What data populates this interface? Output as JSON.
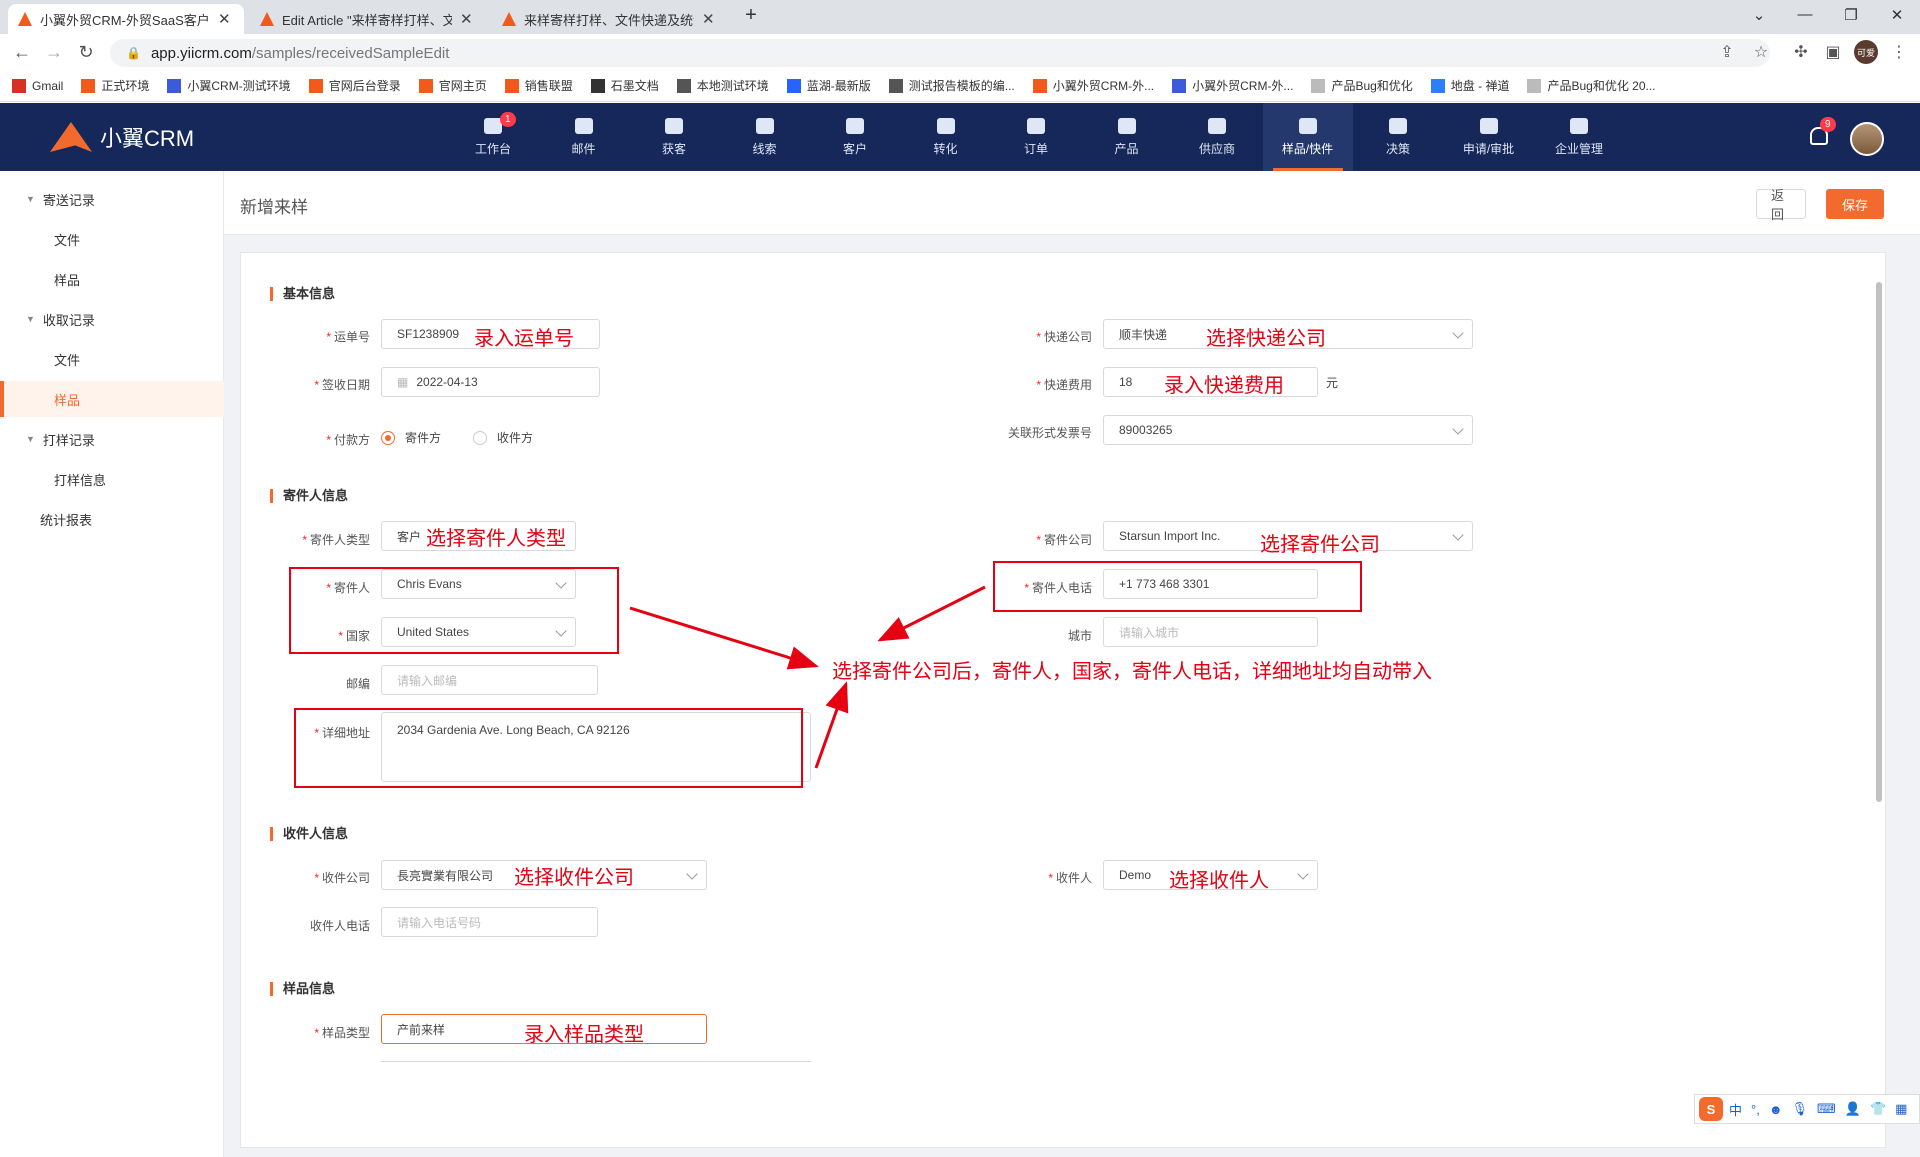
{
  "browser": {
    "tabs": [
      {
        "title": "小翼外贸CRM-外贸SaaS客户管理",
        "active": true
      },
      {
        "title": "Edit Article \"来样寄样打样、文件",
        "active": false
      },
      {
        "title": "来样寄样打样、文件快递及统计 -",
        "active": false
      }
    ],
    "new_tab": "+",
    "url_host": "app.yiicrm.com",
    "url_path": "/samples/receivedSampleEdit",
    "profile_label": "可爱",
    "bookmarks": [
      "Gmail",
      "正式环境",
      "小翼CRM-测试环境",
      "官网后台登录",
      "官网主页",
      "销售联盟",
      "石墨文档",
      "本地测试环境",
      "蓝湖-最新版",
      "测试报告模板的编...",
      "小翼外贸CRM-外...",
      "小翼外贸CRM-外...",
      "产品Bug和优化",
      "地盘 - 禅道",
      "产品Bug和优化 20..."
    ]
  },
  "app": {
    "logo_text": "小翼CRM",
    "nav": [
      {
        "label": "工作台",
        "badge": "1"
      },
      {
        "label": "邮件"
      },
      {
        "label": "获客"
      },
      {
        "label": "线索"
      },
      {
        "label": "客户"
      },
      {
        "label": "转化"
      },
      {
        "label": "订单"
      },
      {
        "label": "产品"
      },
      {
        "label": "供应商"
      },
      {
        "label": "样品/快件",
        "active": true
      },
      {
        "label": "决策"
      },
      {
        "label": "申请/审批"
      },
      {
        "label": "企业管理"
      }
    ],
    "notification_count": "9"
  },
  "sidebar": {
    "items": [
      {
        "label": "寄送记录",
        "type": "group"
      },
      {
        "label": "文件",
        "type": "child"
      },
      {
        "label": "样品",
        "type": "child"
      },
      {
        "label": "收取记录",
        "type": "group"
      },
      {
        "label": "文件",
        "type": "child"
      },
      {
        "label": "样品",
        "type": "child",
        "active": true
      },
      {
        "label": "打样记录",
        "type": "group"
      },
      {
        "label": "打样信息",
        "type": "child"
      },
      {
        "label": "统计报表",
        "type": "plain"
      }
    ]
  },
  "page": {
    "title": "新增来样",
    "back_label": "返回",
    "save_label": "保存"
  },
  "form": {
    "basic": {
      "section": "基本信息",
      "waybill_label": "运单号",
      "waybill_value": "SF1238909",
      "courier_label": "快递公司",
      "courier_value": "顺丰快递",
      "date_label": "签收日期",
      "date_value": "2022-04-13",
      "fee_label": "快递费用",
      "fee_value": "18",
      "fee_unit": "元",
      "payer_label": "付款方",
      "payer_options": [
        "寄件方",
        "收件方"
      ],
      "payer_selected": "寄件方",
      "invoice_label": "关联形式发票号",
      "invoice_value": "89003265"
    },
    "sender": {
      "section": "寄件人信息",
      "type_label": "寄件人类型",
      "type_value": "客户",
      "company_label": "寄件公司",
      "company_value": "Starsun Import Inc.",
      "name_label": "寄件人",
      "name_value": "Chris Evans",
      "phone_label": "寄件人电话",
      "phone_value": "+1 773 468 3301",
      "country_label": "国家",
      "country_value": "United States",
      "city_label": "城市",
      "city_placeholder": "请输入城市",
      "zip_label": "邮编",
      "zip_placeholder": "请输入邮编",
      "address_label": "详细地址",
      "address_value": "2034 Gardenia Ave. Long Beach, CA 92126"
    },
    "receiver": {
      "section": "收件人信息",
      "company_label": "收件公司",
      "company_value": "長亮實業有限公司",
      "person_label": "收件人",
      "person_value": "Demo",
      "phone_label": "收件人电话",
      "phone_placeholder": "请输入电话号码"
    },
    "sample": {
      "section": "样品信息",
      "type_label": "样品类型",
      "type_value": "产前来样"
    }
  },
  "annotations": {
    "waybill": "录入运单号",
    "courier": "选择快递公司",
    "fee": "录入快递费用",
    "sender_type": "选择寄件人类型",
    "sender_company": "选择寄件公司",
    "auto_fill": "选择寄件公司后，寄件人，国家，寄件人电话，详细地址均自动带入",
    "receiver_company": "选择收件公司",
    "receiver_person": "选择收件人",
    "sample_type": "录入样品类型"
  },
  "ime": {
    "mode": "中",
    "punct": "°,"
  },
  "colors": {
    "accent": "#f26a2e",
    "header": "#16285a",
    "annotation": "#e60012"
  }
}
